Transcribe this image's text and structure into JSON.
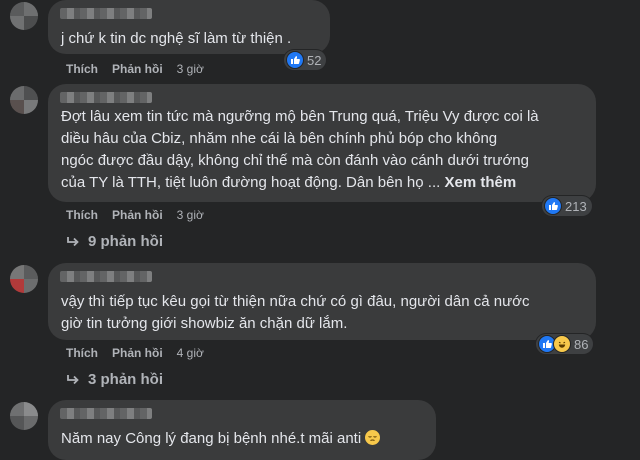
{
  "comments": [
    {
      "text": "j chứ k tin dc nghệ sĩ làm từ thiện .",
      "actions": {
        "like": "Thích",
        "reply": "Phản hồi",
        "time": "3 giờ"
      },
      "reaction_count": "52"
    },
    {
      "text": "Đợt lâu xem tin tức mà ngưỡng mộ bên Trung quá, Triệu Vy được coi là\ndiều hâu của Cbiz, nhăm nhe cái là bên chính phủ bóp cho không\nngóc được đầu dậy, không chỉ thế mà còn đánh vào cánh dưới trướng\ncủa TY là TTH, tiệt luôn đường hoạt động. Dân bên họ ...",
      "see_more": "Xem thêm",
      "actions": {
        "like": "Thích",
        "reply": "Phản hồi",
        "time": "3 giờ"
      },
      "reaction_count": "213",
      "replies": "9 phản hồi"
    },
    {
      "text": "vậy thì tiếp tục kêu gọi từ thiện nữa chứ có gì đâu, người dân cả nước\ngiờ tin tưởng giới showbiz ăn chặn dữ lắm.",
      "actions": {
        "like": "Thích",
        "reply": "Phản hồi",
        "time": "4 giờ"
      },
      "reaction_count": "86",
      "replies": "3 phản hồi"
    },
    {
      "text": "Năm nay Công lý đang bị bệnh nhé.t mãi anti"
    }
  ],
  "icons": {
    "like": "like-icon",
    "haha": "haha-icon",
    "reply_arrow": "reply-arrow-icon",
    "emoji": "pensive-emoji-icon"
  },
  "colors": {
    "background": "#242526",
    "bubble": "#3a3b3c",
    "text": "#e4e6eb",
    "secondary_text": "#b0b3b8",
    "like_blue": "#2078f4"
  }
}
